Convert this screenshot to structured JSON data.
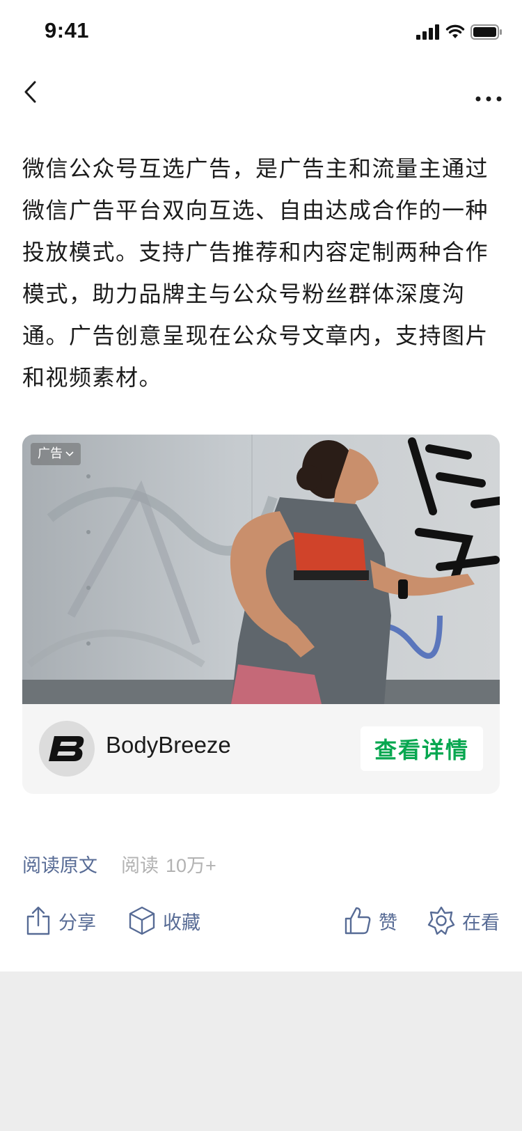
{
  "status_bar": {
    "time": "9:41"
  },
  "nav": {
    "back_icon": "chevron-left-icon",
    "more_icon": "more-horizontal-icon"
  },
  "article": {
    "text": "微信公众号互选广告，是广告主和流量主通过微信广告平台双向互选、自由达成合作的一种投放模式。支持广告推荐和内容定制两种合作模式，助力品牌主与公众号粉丝群体深度沟通。广告创意呈现在公众号文章内，支持图片和视频素材。"
  },
  "ad": {
    "tag_label": "广告",
    "brand_name": "BodyBreeze",
    "brand_logo_letter": "B",
    "cta_label": "查看详情",
    "cta_color": "#07a750"
  },
  "read": {
    "original_label": "阅读原文",
    "count_label": "阅读",
    "count_value": "10万+"
  },
  "actions": {
    "share": "分享",
    "favorite": "收藏",
    "like": "赞",
    "wow": "在看"
  },
  "colors": {
    "link": "#576b95",
    "muted": "#b2b2b2",
    "bottom_bg": "#ededed"
  }
}
